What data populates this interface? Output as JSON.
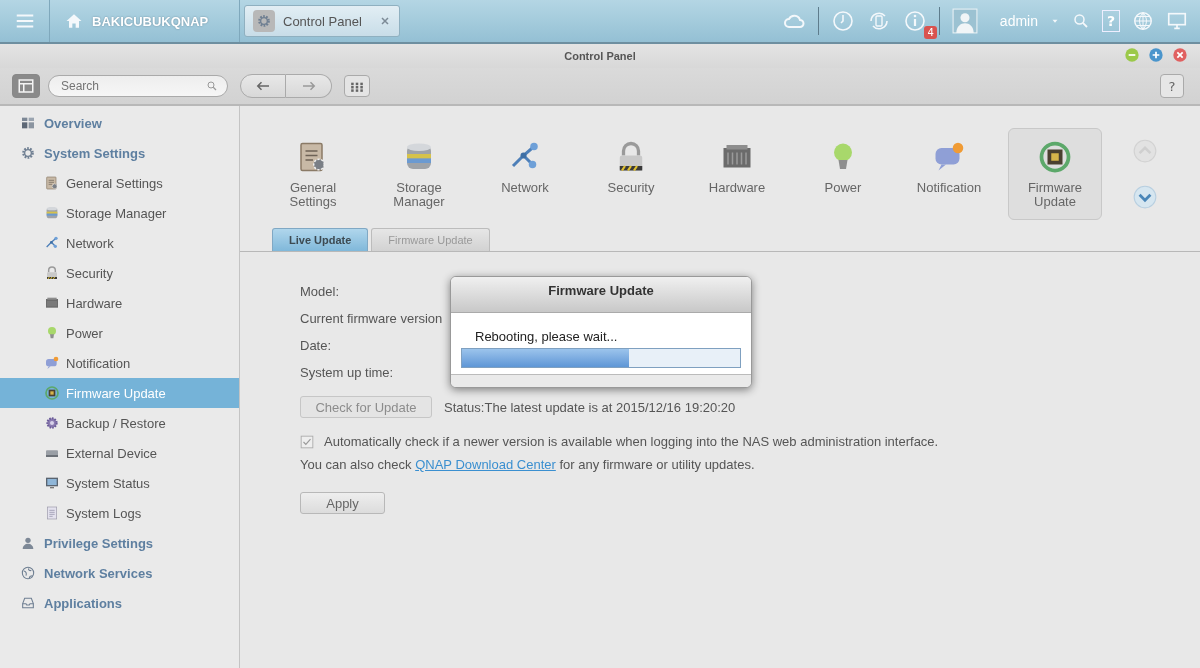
{
  "top_bar": {
    "host": "BAKICUBUKQNAP",
    "app_tab": {
      "label": "Control Panel"
    },
    "notification_count": "4",
    "user": "admin",
    "help_label": "?"
  },
  "window": {
    "title": "Control Panel"
  },
  "toolbar": {
    "search": {
      "placeholder": "Search"
    },
    "help_label": "?"
  },
  "sidebar": {
    "items": [
      {
        "label": "Overview",
        "selected": false
      },
      {
        "label": "System Settings",
        "selected": false,
        "children": [
          {
            "label": "General Settings",
            "selected": false
          },
          {
            "label": "Storage Manager",
            "selected": false
          },
          {
            "label": "Network",
            "selected": false
          },
          {
            "label": "Security",
            "selected": false
          },
          {
            "label": "Hardware",
            "selected": false
          },
          {
            "label": "Power",
            "selected": false
          },
          {
            "label": "Notification",
            "selected": false
          },
          {
            "label": "Firmware Update",
            "selected": true
          },
          {
            "label": "Backup / Restore",
            "selected": false
          },
          {
            "label": "External Device",
            "selected": false
          },
          {
            "label": "System Status",
            "selected": false
          },
          {
            "label": "System Logs",
            "selected": false
          }
        ]
      },
      {
        "label": "Privilege Settings",
        "selected": false
      },
      {
        "label": "Network Services",
        "selected": false
      },
      {
        "label": "Applications",
        "selected": false
      }
    ]
  },
  "categories": [
    {
      "label": "General Settings",
      "selected": false
    },
    {
      "label": "Storage Manager",
      "selected": false
    },
    {
      "label": "Network",
      "selected": false
    },
    {
      "label": "Security",
      "selected": false
    },
    {
      "label": "Hardware",
      "selected": false
    },
    {
      "label": "Power",
      "selected": false
    },
    {
      "label": "Notification",
      "selected": false
    },
    {
      "label": "Firmware Update",
      "selected": true
    }
  ],
  "tabs": [
    {
      "label": "Live Update",
      "selected": true
    },
    {
      "label": "Firmware Update",
      "selected": false
    }
  ],
  "form": {
    "fields": [
      {
        "label": "Model:"
      },
      {
        "label": "Current firmware version"
      },
      {
        "label": "Date:"
      },
      {
        "label": "System up time:"
      }
    ],
    "check_button": {
      "label": "Check for Update",
      "disabled": true
    },
    "status": "Status:The latest update is at 2015/12/16 19:20:20",
    "auto_check": {
      "label": "Automatically check if a newer version is available when logging into the NAS web administration interface.",
      "checked": true
    },
    "note": {
      "before": "You can also check ",
      "link": "QNAP Download Center",
      "after": " for any firmware or utility updates."
    },
    "apply_button": "Apply"
  },
  "dialog": {
    "title": "Firmware Update",
    "message": "Rebooting, please wait...",
    "level": 0.6
  }
}
